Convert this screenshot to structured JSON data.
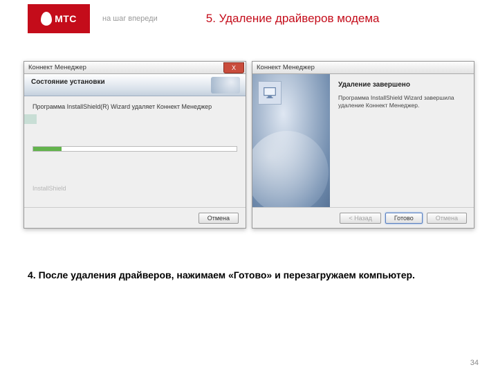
{
  "header": {
    "logo_text": "МТС",
    "tagline": "на шаг впереди",
    "title": "5. Удаление драйверов модема"
  },
  "left_dialog": {
    "titlebar": "Коннект Менеджер",
    "close": "X",
    "heading": "Состояние установки",
    "message": "Программа InstallShield(R) Wizard удаляет Коннект Менеджер",
    "footer_brand": "InstallShield",
    "cancel": "Отмена"
  },
  "right_dialog": {
    "titlebar": "Коннект Менеджер",
    "heading": "Удаление завершено",
    "message": "Программа InstallShield Wizard завершила удаление Коннект Менеджер.",
    "back": "< Назад",
    "finish": "Готово",
    "cancel": "Отмена"
  },
  "caption": "4. После удаления драйверов, нажимаем «Готово» и перезагружаем компьютер.",
  "page_number": "34"
}
